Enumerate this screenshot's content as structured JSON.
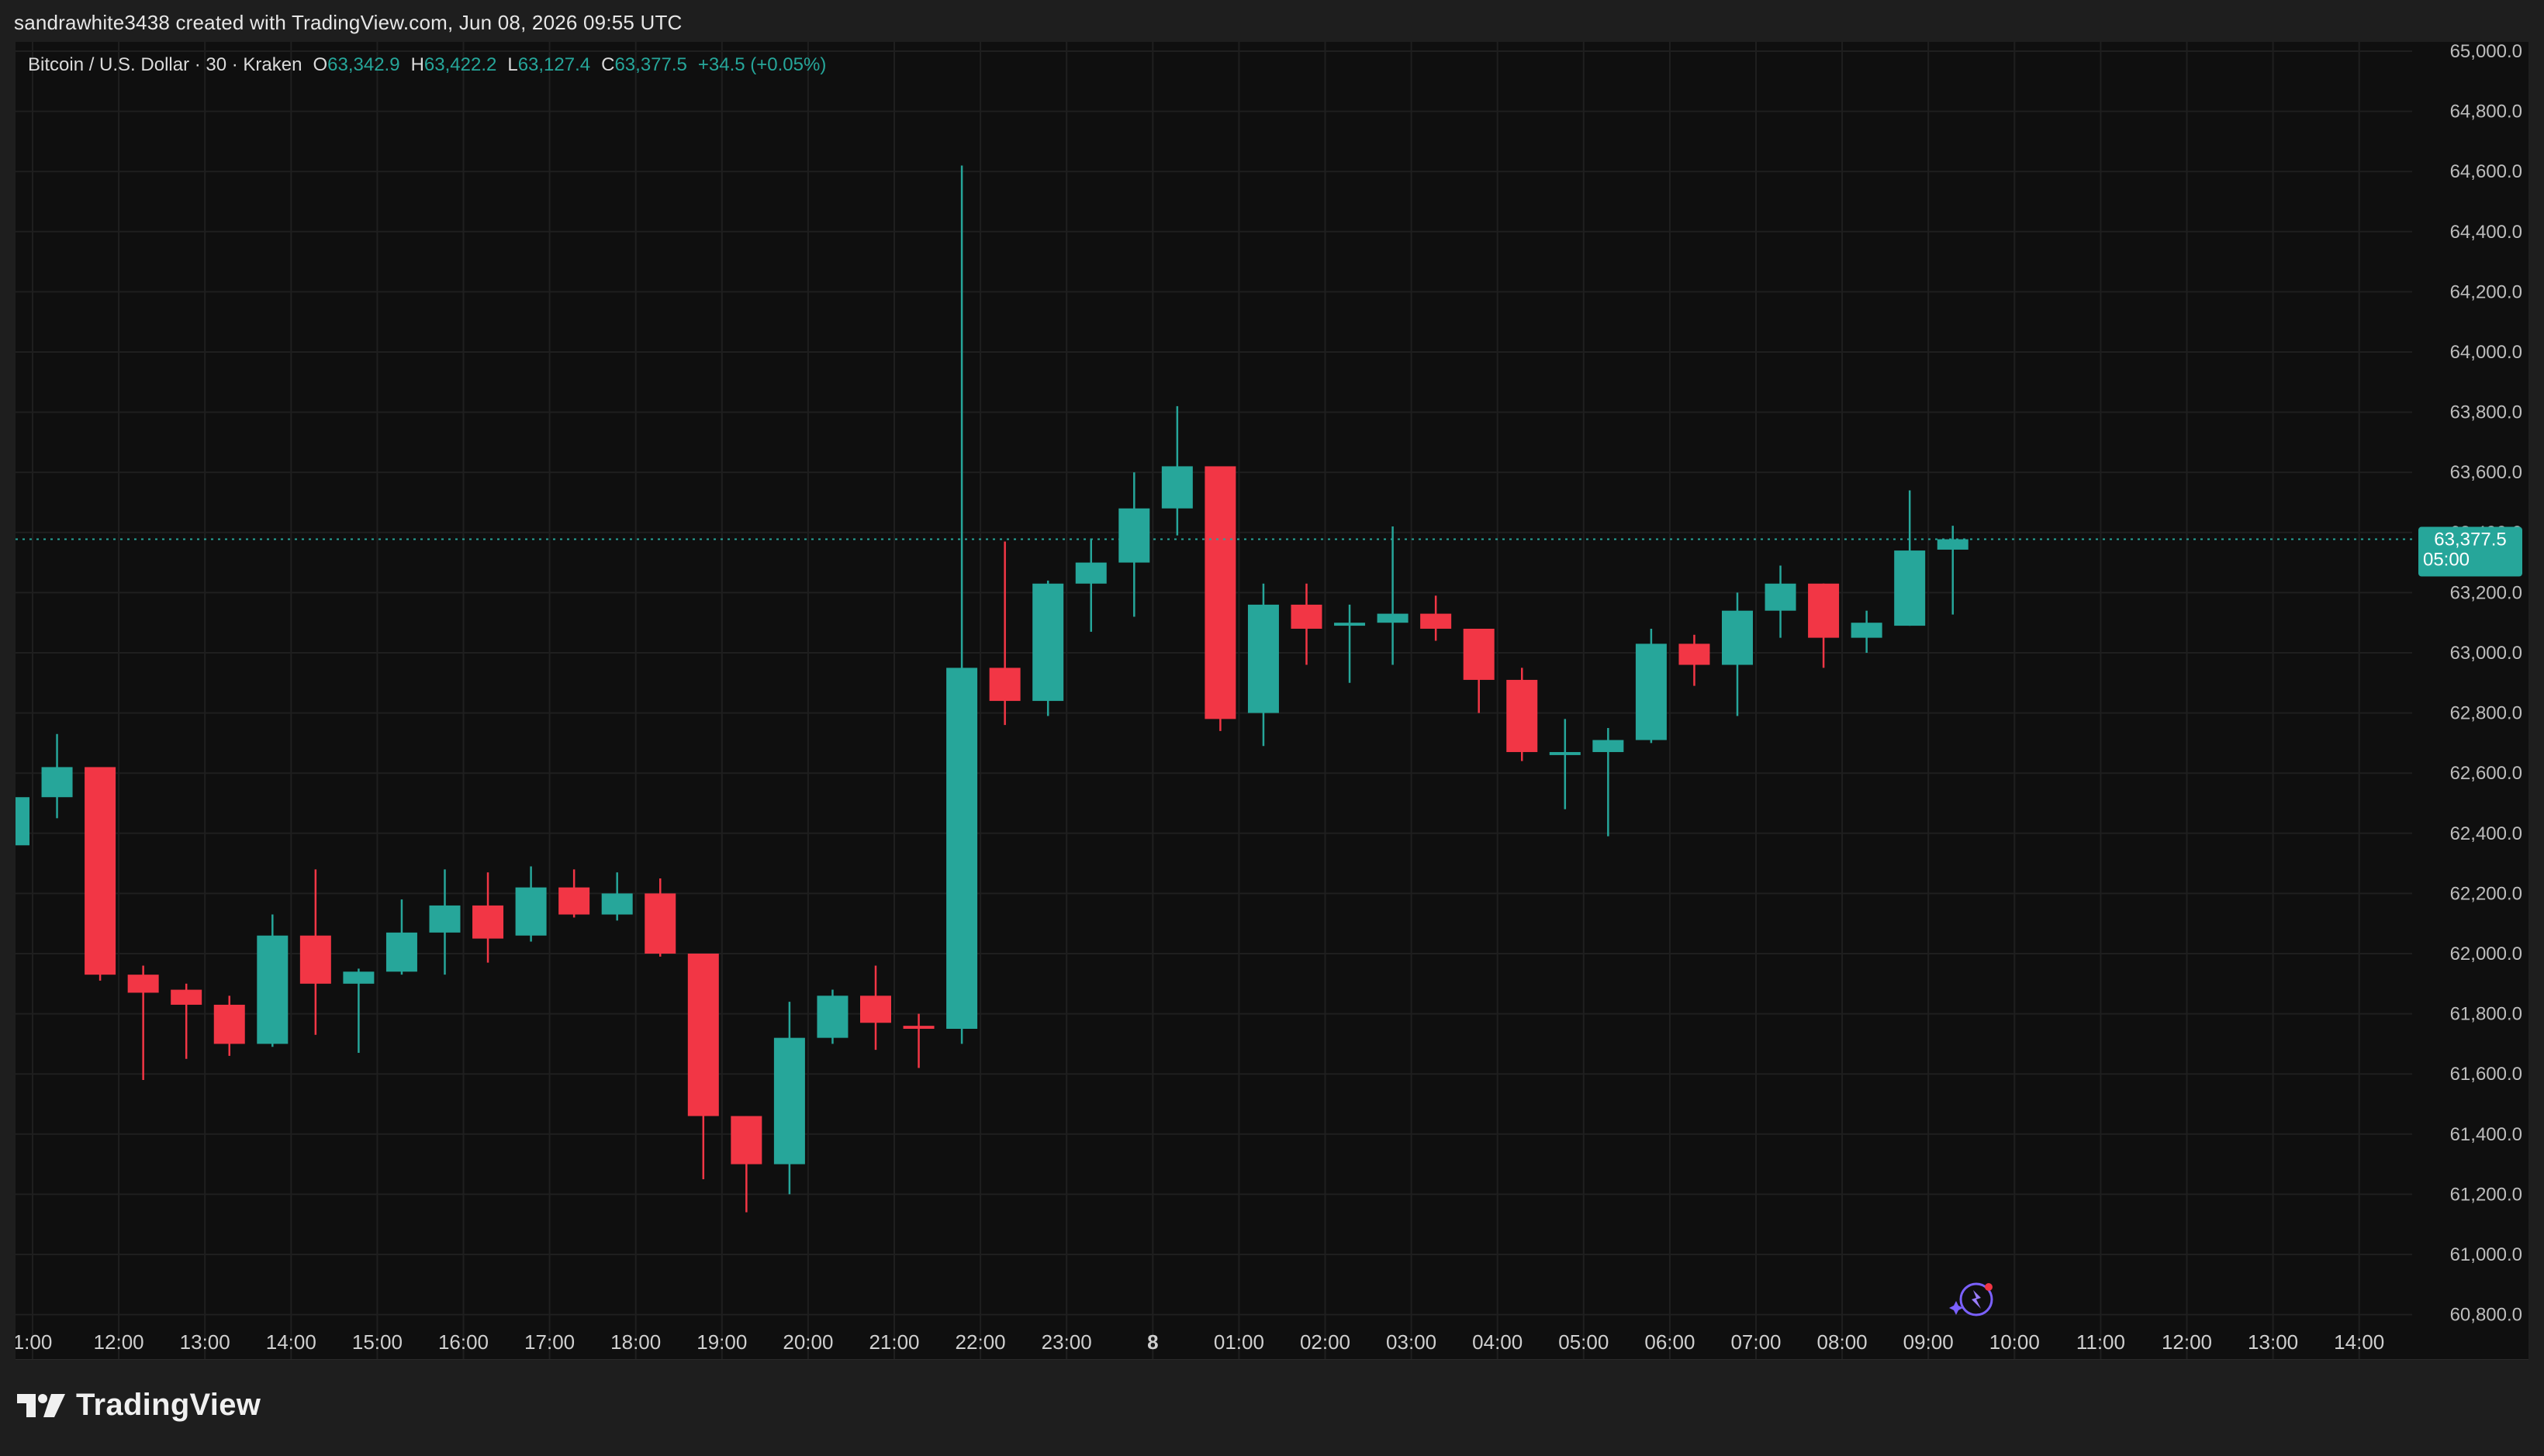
{
  "header": {
    "caption": "sandrawhite3438 created with TradingView.com, Jun 08, 2026 09:55 UTC"
  },
  "legend": {
    "symbol": "Bitcoin / U.S. Dollar · 30 · Kraken",
    "open_label": "O",
    "open": "63,342.9",
    "high_label": "H",
    "high": "63,422.2",
    "low_label": "L",
    "low": "63,127.4",
    "close_label": "C",
    "close": "63,377.5",
    "change": "+34.5 (+0.05%)"
  },
  "price_badge": {
    "price": "63,377.5",
    "countdown": "05:00"
  },
  "footer": {
    "brand": "TradingView"
  },
  "colors": {
    "up": "#26a69a",
    "down": "#f23645",
    "background": "#0f0f0f",
    "grid": "#1f1f1f",
    "text": "#dbdbdb",
    "badge": "#26a69a"
  },
  "chart_data": {
    "type": "candlestick",
    "y_range": [
      60800,
      65000
    ],
    "y_ticks": [
      "65,000.0",
      "64,800.0",
      "64,600.0",
      "64,400.0",
      "64,200.0",
      "64,000.0",
      "63,800.0",
      "63,600.0",
      "63,400.0",
      "63,200.0",
      "63,000.0",
      "62,800.0",
      "62,600.0",
      "62,400.0",
      "62,200.0",
      "62,000.0",
      "61,800.0",
      "61,600.0",
      "61,400.0",
      "61,200.0",
      "61,000.0",
      "60,800.0"
    ],
    "x_ticks": [
      "1:00",
      "12:00",
      "13:00",
      "14:00",
      "15:00",
      "16:00",
      "17:00",
      "18:00",
      "19:00",
      "20:00",
      "21:00",
      "22:00",
      "23:00",
      "8",
      "01:00",
      "02:00",
      "03:00",
      "04:00",
      "05:00",
      "06:00",
      "07:00",
      "08:00",
      "09:00",
      "10:00",
      "11:00",
      "12:00",
      "13:00",
      "14:00"
    ],
    "current_price": 63377.5,
    "candles": [
      {
        "time": "11:30",
        "open": 62360,
        "high": 62540,
        "low": 62350,
        "close": 62520
      },
      {
        "time": "12:00",
        "open": 62520,
        "high": 62730,
        "low": 62450,
        "close": 62620
      },
      {
        "time": "12:30",
        "open": 62620,
        "high": 62620,
        "low": 61910,
        "close": 61930
      },
      {
        "time": "13:00",
        "open": 61930,
        "high": 61960,
        "low": 61580,
        "close": 61870
      },
      {
        "time": "13:30",
        "open": 61880,
        "high": 61900,
        "low": 61650,
        "close": 61830
      },
      {
        "time": "14:00",
        "open": 61830,
        "high": 61860,
        "low": 61660,
        "close": 61700
      },
      {
        "time": "14:30",
        "open": 61700,
        "high": 62130,
        "low": 61690,
        "close": 62060
      },
      {
        "time": "15:00",
        "open": 62060,
        "high": 62280,
        "low": 61730,
        "close": 61900
      },
      {
        "time": "15:30",
        "open": 61900,
        "high": 61950,
        "low": 61670,
        "close": 61940
      },
      {
        "time": "16:00",
        "open": 61940,
        "high": 62180,
        "low": 61930,
        "close": 62070
      },
      {
        "time": "16:30",
        "open": 62070,
        "high": 62280,
        "low": 61930,
        "close": 62160
      },
      {
        "time": "17:00",
        "open": 62160,
        "high": 62270,
        "low": 61970,
        "close": 62050
      },
      {
        "time": "17:30",
        "open": 62060,
        "high": 62290,
        "low": 62040,
        "close": 62220
      },
      {
        "time": "18:00",
        "open": 62220,
        "high": 62280,
        "low": 62120,
        "close": 62130
      },
      {
        "time": "18:30",
        "open": 62130,
        "high": 62270,
        "low": 62110,
        "close": 62200
      },
      {
        "time": "19:00",
        "open": 62200,
        "high": 62250,
        "low": 61990,
        "close": 62000
      },
      {
        "time": "19:30",
        "open": 62000,
        "high": 62000,
        "low": 61250,
        "close": 61460
      },
      {
        "time": "20:00",
        "open": 61460,
        "high": 61460,
        "low": 61140,
        "close": 61300
      },
      {
        "time": "20:30",
        "open": 61300,
        "high": 61840,
        "low": 61200,
        "close": 61720
      },
      {
        "time": "21:00",
        "open": 61720,
        "high": 61880,
        "low": 61700,
        "close": 61860
      },
      {
        "time": "21:30",
        "open": 61860,
        "high": 61960,
        "low": 61680,
        "close": 61770
      },
      {
        "time": "22:00",
        "open": 61760,
        "high": 61800,
        "low": 61620,
        "close": 61750
      },
      {
        "time": "22:30",
        "open": 61750,
        "high": 64620,
        "low": 61700,
        "close": 62950
      },
      {
        "time": "23:00",
        "open": 62950,
        "high": 63370,
        "low": 62760,
        "close": 62840
      },
      {
        "time": "23:30",
        "open": 62840,
        "high": 63240,
        "low": 62790,
        "close": 63230
      },
      {
        "time": "00:00",
        "open": 63230,
        "high": 63380,
        "low": 63070,
        "close": 63300
      },
      {
        "time": "00:30",
        "open": 63300,
        "high": 63600,
        "low": 63120,
        "close": 63480
      },
      {
        "time": "01:00",
        "open": 63480,
        "high": 63820,
        "low": 63390,
        "close": 63620
      },
      {
        "time": "01:30",
        "open": 63620,
        "high": 63620,
        "low": 62740,
        "close": 62780
      },
      {
        "time": "02:00",
        "open": 62800,
        "high": 63230,
        "low": 62690,
        "close": 63160
      },
      {
        "time": "02:30",
        "open": 63160,
        "high": 63230,
        "low": 62960,
        "close": 63080
      },
      {
        "time": "03:00",
        "open": 63090,
        "high": 63160,
        "low": 62900,
        "close": 63100
      },
      {
        "time": "03:30",
        "open": 63100,
        "high": 63420,
        "low": 62960,
        "close": 63130
      },
      {
        "time": "04:00",
        "open": 63130,
        "high": 63190,
        "low": 63040,
        "close": 63080
      },
      {
        "time": "04:30",
        "open": 63080,
        "high": 63080,
        "low": 62800,
        "close": 62910
      },
      {
        "time": "05:00",
        "open": 62910,
        "high": 62950,
        "low": 62640,
        "close": 62670
      },
      {
        "time": "05:30",
        "open": 62660,
        "high": 62780,
        "low": 62480,
        "close": 62670
      },
      {
        "time": "06:00",
        "open": 62670,
        "high": 62750,
        "low": 62390,
        "close": 62710
      },
      {
        "time": "06:30",
        "open": 62710,
        "high": 63080,
        "low": 62700,
        "close": 63030
      },
      {
        "time": "07:00",
        "open": 63030,
        "high": 63060,
        "low": 62890,
        "close": 62960
      },
      {
        "time": "07:30",
        "open": 62960,
        "high": 63200,
        "low": 62790,
        "close": 63140
      },
      {
        "time": "08:00",
        "open": 63140,
        "high": 63290,
        "low": 63050,
        "close": 63230
      },
      {
        "time": "08:30",
        "open": 63230,
        "high": 63230,
        "low": 62950,
        "close": 63050
      },
      {
        "time": "09:00",
        "open": 63050,
        "high": 63140,
        "low": 63000,
        "close": 63100
      },
      {
        "time": "09:30",
        "open": 63090,
        "high": 63540,
        "low": 63090,
        "close": 63340
      },
      {
        "time": "10:00",
        "open": 63342.9,
        "high": 63422.2,
        "low": 63127.4,
        "close": 63377.5
      }
    ]
  }
}
